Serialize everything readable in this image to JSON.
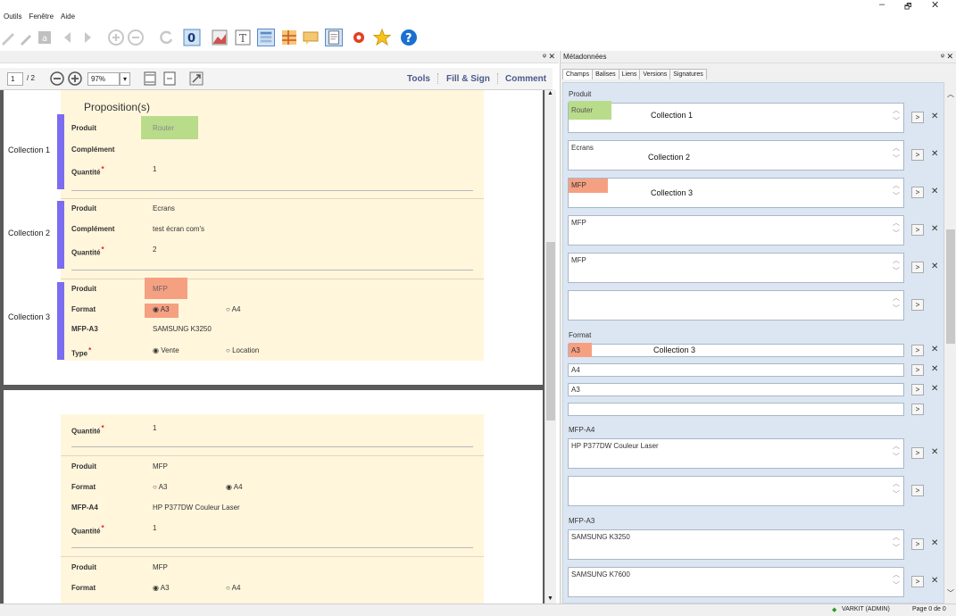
{
  "window": {
    "minimize": "–",
    "maximize": "🗗",
    "close": "✕"
  },
  "menu": [
    "Outils",
    "Fenêtre",
    "Aide"
  ],
  "pdf_toolbar": {
    "page_current": "1",
    "page_total": "/ 2",
    "zoom": "97%",
    "tools": "Tools",
    "fill_sign": "Fill & Sign",
    "comment": "Comment"
  },
  "left_dock": {
    "pin": "ᵠ ✕"
  },
  "form": {
    "section_title": "Proposition(s)",
    "page1": {
      "collections": [
        {
          "name": "Collection 1",
          "rows": [
            {
              "label": "Produit",
              "value": "Router",
              "req": false
            },
            {
              "label": "Complément",
              "value": "",
              "req": false
            },
            {
              "label": "Quantité",
              "value": "1",
              "req": true
            }
          ]
        },
        {
          "name": "Collection 2",
          "rows": [
            {
              "label": "Produit",
              "value": "Ecrans",
              "req": false
            },
            {
              "label": "Complément",
              "value": "test écran com's",
              "req": false
            },
            {
              "label": "Quantité",
              "value": "2",
              "req": true
            }
          ]
        },
        {
          "name": "Collection 3",
          "rows": [
            {
              "label": "Produit",
              "value": "MFP",
              "req": false
            },
            {
              "label": "Format",
              "value": "",
              "req": false
            },
            {
              "label": "MFP-A3",
              "value": "SAMSUNG K3250",
              "req": false
            },
            {
              "label": "Type",
              "value": "",
              "req": true
            }
          ],
          "format_options": [
            "A3",
            "A4"
          ],
          "type_options": [
            "Vente",
            "Location"
          ]
        }
      ]
    },
    "page2": {
      "rows_a": [
        {
          "label": "Quantité",
          "value": "1",
          "req": true
        }
      ],
      "rows_b": [
        {
          "label": "Produit",
          "value": "MFP"
        },
        {
          "label": "Format",
          "value": ""
        },
        {
          "label": "MFP-A4",
          "value": "HP P377DW Couleur Laser"
        },
        {
          "label": "Quantité",
          "value": "1"
        }
      ],
      "format_b": [
        "A3",
        "A4"
      ],
      "rows_c": [
        {
          "label": "Produit",
          "value": "MFP"
        },
        {
          "label": "Format",
          "value": ""
        }
      ],
      "format_c": [
        "A3",
        "A4"
      ]
    }
  },
  "meta": {
    "title": "Métadonnées",
    "pin": "ᵠ ✕",
    "tabs": [
      "Champs",
      "Balises",
      "Liens",
      "Versions",
      "Signatures"
    ],
    "produit_label": "Produit",
    "produit_values": [
      "Router",
      "Ecrans",
      "MFP",
      "MFP",
      "MFP",
      ""
    ],
    "produit_overlays": [
      "Collection 1",
      "Collection 2",
      "Collection 3"
    ],
    "format_label": "Format",
    "format_values": [
      "A3",
      "A4",
      "A3",
      ""
    ],
    "format_overlay": "Collection 3",
    "mfpa4_label": "MFP-A4",
    "mfpa4_values": [
      "HP P377DW Couleur Laser",
      ""
    ],
    "mfpa3_label": "MFP-A3",
    "mfpa3_values": [
      "SAMSUNG K3250",
      "SAMSUNG K7600"
    ],
    "arrow": ">",
    "remove": "✕",
    "spin": "︿ ﹀"
  },
  "status": {
    "user": "VARKIT (ADMIN)",
    "page": "Page 0 de 0"
  },
  "colors": {
    "accent_bar": "#7b6cf0",
    "form_bg": "#fff6dc",
    "green_hl": "#b9dc8a",
    "orange_hl": "#f6a082"
  }
}
